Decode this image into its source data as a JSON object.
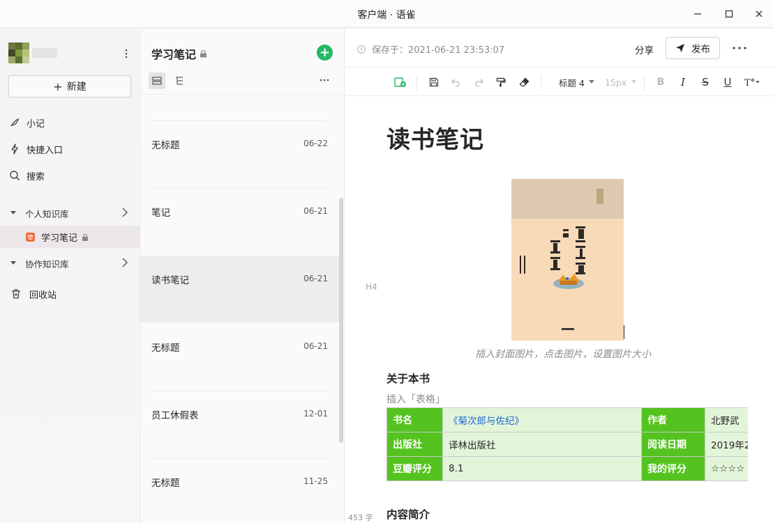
{
  "window": {
    "title": "客户端 · 语雀"
  },
  "sidebar": {
    "new_label": "新建",
    "nav": [
      {
        "label": "小记",
        "icon": "feather-icon"
      },
      {
        "label": "快捷入口",
        "icon": "lightning-icon"
      },
      {
        "label": "搜索",
        "icon": "search-icon"
      }
    ],
    "personal_kb": "个人知识库",
    "current_kb": "学习笔记",
    "team_kb": "协作知识库",
    "trash": "回收站"
  },
  "doclist": {
    "title": "学习笔记",
    "docs": [
      {
        "title": "无标题",
        "date": "06-22"
      },
      {
        "title": "笔记",
        "date": "06-21"
      },
      {
        "title": "读书笔记",
        "date": "06-21"
      },
      {
        "title": "无标题",
        "date": "06-21"
      },
      {
        "title": "员工休假表",
        "date": "12-01"
      },
      {
        "title": "无标题",
        "date": "11-25"
      }
    ]
  },
  "editor": {
    "saved": "保存于：2021-06-21 23:53:07",
    "share": "分享",
    "publish": "发布",
    "toolbar": {
      "heading": "标题 4",
      "font_size": "15px"
    },
    "doc_title": "读书笔记",
    "block_marker": "H4",
    "caption": "插入封面图片，点击图片，设置图片大小",
    "about_heading": "关于本书",
    "insert_hint": "插入「表格」",
    "table": [
      [
        "书名",
        "《菊次郎与佐纪》",
        "作者",
        "北野武"
      ],
      [
        "出版社",
        "译林出版社",
        "阅读日期",
        "2019年2"
      ],
      [
        "豆瓣评分",
        "8.1",
        "我的评分",
        "☆☆☆☆"
      ]
    ],
    "intro_heading": "内容简介",
    "word_count": "453 字"
  }
}
